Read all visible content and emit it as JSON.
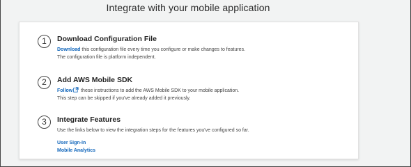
{
  "page": {
    "title": "Integrate with your mobile application"
  },
  "steps": [
    {
      "number": "1",
      "title": "Download Configuration File",
      "link_label": "Download",
      "line1": " this configuration file every time you configure or make changes to features.",
      "line2": "The configuration file is platform independent."
    },
    {
      "number": "2",
      "title": "Add AWS Mobile SDK",
      "link_label": "Follow",
      "icon": "external-link-icon",
      "line1": " these instructions to add the AWS Mobile SDK to your mobile application.",
      "line2": "This step can be skipped if you've already added it previously."
    },
    {
      "number": "3",
      "title": "Integrate Features",
      "line1": "Use the links below to view the integration steps for the features you've configured so far.",
      "links": [
        "User Sign-In",
        "Mobile Analytics"
      ]
    }
  ],
  "colors": {
    "link": "#1166bb",
    "background": "#f2f3f3",
    "card": "#ffffff"
  }
}
